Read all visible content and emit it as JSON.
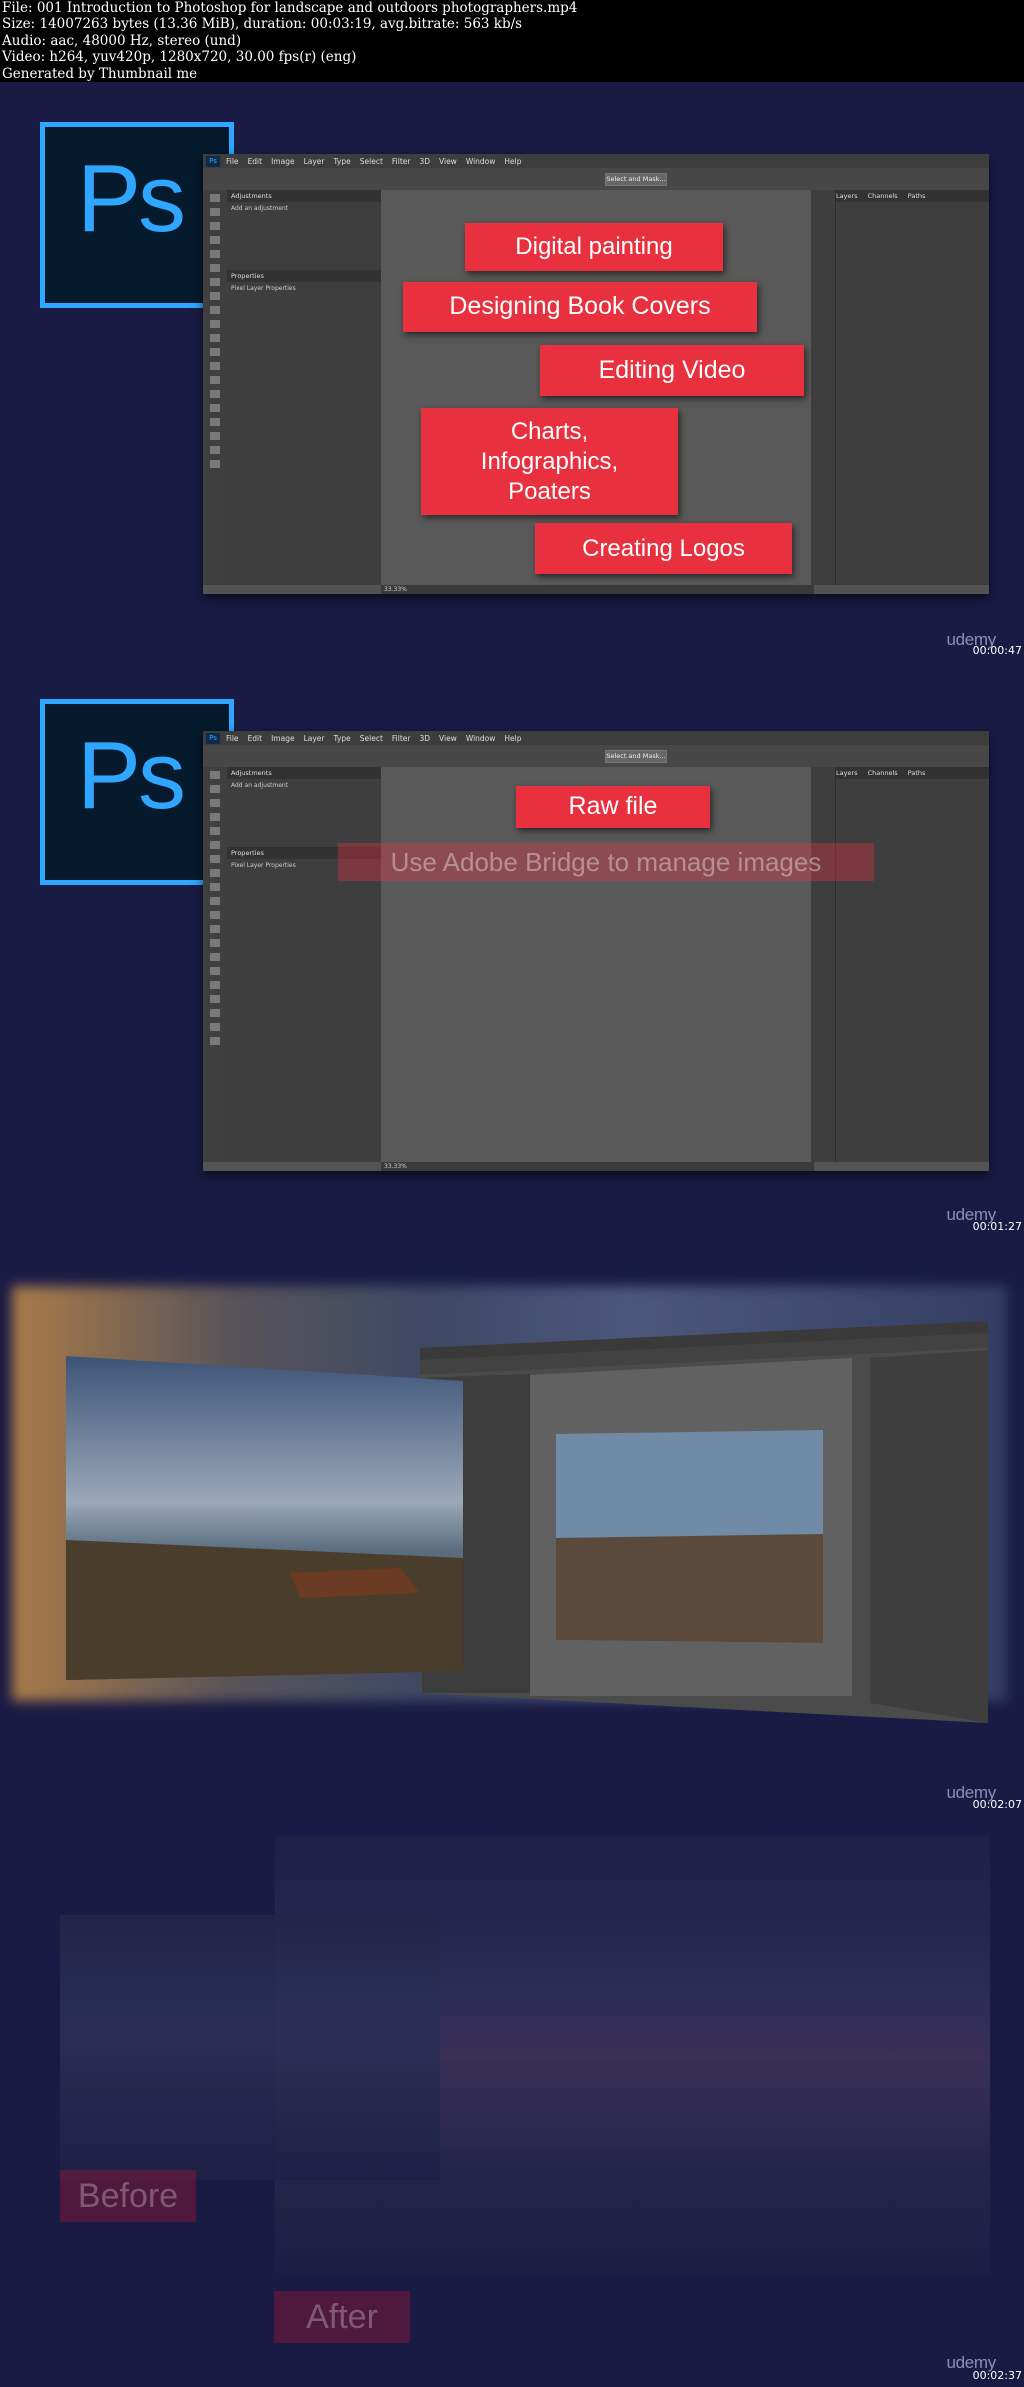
{
  "header": {
    "lines": [
      "File: 001 Introduction to Photoshop for landscape and outdoors photographers.mp4",
      "Size: 14007263 bytes (13.36 MiB), duration: 00:03:19, avg.bitrate: 563 kb/s",
      "Audio: aac, 48000 Hz, stereo (und)",
      "Video: h264, yuv420p, 1280x720, 30.00 fps(r) (eng)",
      "Generated by Thumbnail me"
    ]
  },
  "ps_logo_text": "Ps",
  "ps_menu": [
    "File",
    "Edit",
    "Image",
    "Layer",
    "Type",
    "Select",
    "Filter",
    "3D",
    "View",
    "Window",
    "Help"
  ],
  "ps_options": {
    "select_and_mask": "Select and Mask..."
  },
  "ps_panels": {
    "adjustments": "Adjustments",
    "add_adjustment": "Add an adjustment",
    "properties": "Properties",
    "pixel_layer": "Pixel Layer Properties",
    "layers": "Layers",
    "channels": "Channels",
    "paths": "Paths",
    "zoom": "33.33%"
  },
  "frames": [
    {
      "timestamp": "00:00:47",
      "watermark": "udemy",
      "labels": [
        "Digital painting",
        "Designing Book Covers",
        "Editing Video",
        "Charts,\nInfographics,\nPoaters",
        "Creating Logos"
      ]
    },
    {
      "timestamp": "00:01:27",
      "watermark": "udemy",
      "labels": [
        "Raw file"
      ],
      "ghost_label": "Use Adobe Bridge to manage images"
    },
    {
      "timestamp": "00:02:07",
      "watermark": "udemy"
    },
    {
      "timestamp": "00:02:37",
      "watermark": "udemy",
      "before": "Before",
      "after": "After"
    }
  ],
  "colors": {
    "background": "#1a1b45",
    "accent_red": "#e8303f",
    "ps_blue": "#2fa6ff"
  }
}
